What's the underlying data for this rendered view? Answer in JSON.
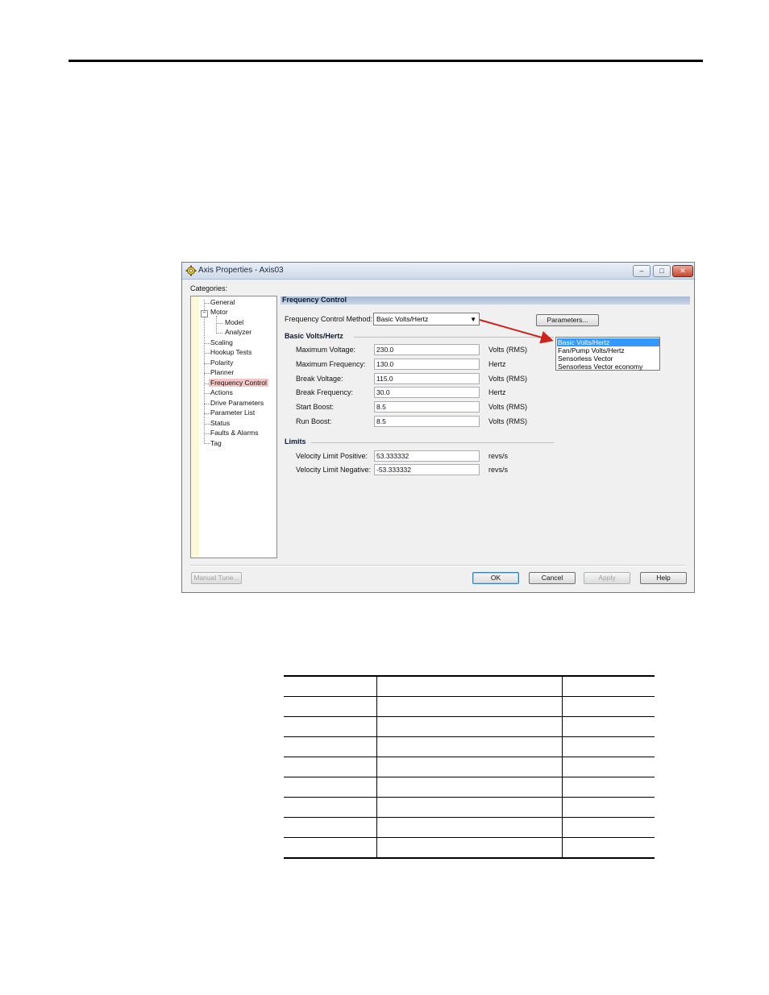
{
  "dialog": {
    "title": "Axis Properties - Axis03",
    "window_buttons": {
      "minimize": "–",
      "maximize": "□",
      "close": "✕"
    },
    "categories_label": "Categories:",
    "categories": [
      "General",
      "Motor",
      "Model",
      "Analyzer",
      "Scaling",
      "Hookup Tests",
      "Polarity",
      "Planner",
      "Frequency Control",
      "Actions",
      "Drive Parameters",
      "Parameter List",
      "Status",
      "Faults & Alarms",
      "Tag"
    ],
    "selected_category": "Frequency Control",
    "section_title": "Frequency Control",
    "method_label": "Frequency Control Method:",
    "method_value": "Basic Volts/Hertz",
    "parameters_button": "Parameters...",
    "basic_group_title": "Basic Volts/Hertz",
    "basic_fields": [
      {
        "label": "Maximum Voltage:",
        "value": "230.0",
        "unit": "Volts (RMS)"
      },
      {
        "label": "Maximum Frequency:",
        "value": "130.0",
        "unit": "Hertz"
      },
      {
        "label": "Break Voltage:",
        "value": "115.0",
        "unit": "Volts (RMS)"
      },
      {
        "label": "Break Frequency:",
        "value": "30.0",
        "unit": "Hertz"
      },
      {
        "label": "Start Boost:",
        "value": "8.5",
        "unit": "Volts (RMS)"
      },
      {
        "label": "Run Boost:",
        "value": "8.5",
        "unit": "Volts (RMS)"
      }
    ],
    "limits_group_title": "Limits",
    "limits_fields": [
      {
        "label": "Velocity Limit Positive:",
        "value": "53.333332",
        "unit": "revs/s"
      },
      {
        "label": "Velocity Limit Negative:",
        "value": "-53.333332",
        "unit": "revs/s"
      }
    ],
    "dropdown_options": [
      "Basic Volts/Hertz",
      "Fan/Pump Volts/Hertz",
      "Sensorless Vector",
      "Sensorless Vector economy"
    ],
    "buttons": {
      "manual_tune": "Manual Tune...",
      "ok": "OK",
      "cancel": "Cancel",
      "apply": "Apply",
      "help": "Help"
    },
    "colors": {
      "callout_arrow": "#d0211b",
      "selection": "#3399ff",
      "category_highlight": "#f4c6c6"
    }
  }
}
